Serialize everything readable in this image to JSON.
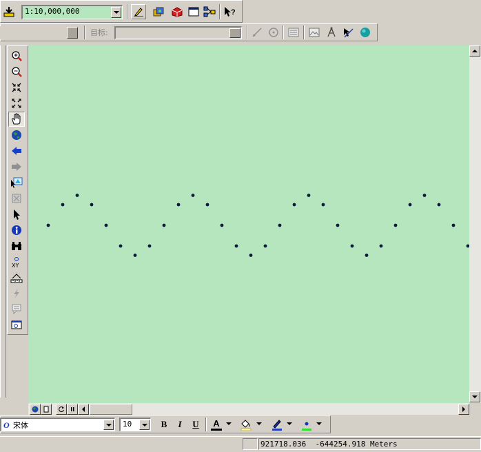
{
  "toolbar_top": {
    "scale_value": "1:10,000,000",
    "icons": [
      "add-data-icon",
      "editor-icon",
      "arccatalog-icon",
      "arctoolbox-icon",
      "command-line-icon",
      "model-builder-icon",
      "whats-this-icon"
    ]
  },
  "editor_toolbar": {
    "target_label": "目标:",
    "target_value": ""
  },
  "tools_toolbar": {
    "icons": [
      "zoom-in-icon",
      "zoom-out-icon",
      "fixed-zoom-in-icon",
      "fixed-zoom-out-icon",
      "pan-icon",
      "full-extent-icon",
      "back-extent-icon",
      "forward-extent-icon",
      "select-features-icon",
      "clear-selection-icon",
      "select-elements-icon",
      "identify-icon",
      "find-icon",
      "go-to-xy-icon",
      "measure-icon",
      "hyperlink-icon",
      "html-popup-icon",
      "time-slider-icon"
    ]
  },
  "drawing_toolbar": {
    "font_name": "宋体",
    "font_size": "10",
    "bold_label": "B",
    "italic_label": "I",
    "underline_label": "U",
    "font_color_label": "A"
  },
  "status_bar": {
    "coordinates": "921718.036  -644254.918 Meters"
  },
  "map_points": [
    {
      "x": 0,
      "y": 0.0
    },
    {
      "x": 1,
      "y": 1.0
    },
    {
      "x": 2,
      "y": 1.45
    },
    {
      "x": 3,
      "y": 1.0
    },
    {
      "x": 4,
      "y": 0.0
    },
    {
      "x": 5,
      "y": -1.0
    },
    {
      "x": 6,
      "y": -1.45
    },
    {
      "x": 7,
      "y": -1.0
    },
    {
      "x": 8,
      "y": 0.0
    },
    {
      "x": 9,
      "y": 1.0
    },
    {
      "x": 10,
      "y": 1.45
    },
    {
      "x": 11,
      "y": 1.0
    },
    {
      "x": 12,
      "y": 0.0
    },
    {
      "x": 13,
      "y": -1.0
    },
    {
      "x": 14,
      "y": -1.45
    },
    {
      "x": 15,
      "y": -1.0
    },
    {
      "x": 16,
      "y": 0.0
    },
    {
      "x": 17,
      "y": 1.0
    },
    {
      "x": 18,
      "y": 1.45
    },
    {
      "x": 19,
      "y": 1.0
    },
    {
      "x": 20,
      "y": 0.0
    },
    {
      "x": 21,
      "y": -1.0
    },
    {
      "x": 22,
      "y": -1.45
    },
    {
      "x": 23,
      "y": -1.0
    },
    {
      "x": 24,
      "y": 0.0
    },
    {
      "x": 25,
      "y": 1.0
    },
    {
      "x": 26,
      "y": 1.45
    },
    {
      "x": 27,
      "y": 1.0
    },
    {
      "x": 28,
      "y": 0.0
    },
    {
      "x": 29,
      "y": -1.0
    }
  ],
  "colors": {
    "map_background": "#b5e6bd",
    "point": "#0a1a3a",
    "chrome": "#d4d0c8"
  }
}
